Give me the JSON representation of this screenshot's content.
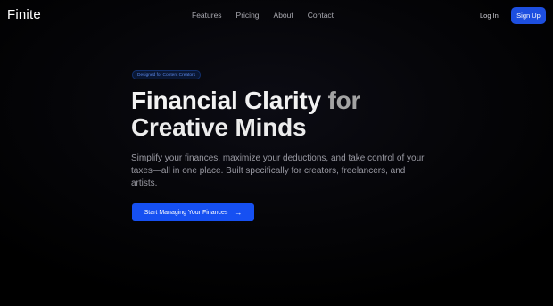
{
  "header": {
    "brand": "Finite",
    "nav": [
      "Features",
      "Pricing",
      "About",
      "Contact"
    ],
    "login_label": "Log In",
    "signup_label": "Sign Up"
  },
  "hero": {
    "badge": "Designed for Content Creators",
    "title_part1": "Financial Clarity",
    "title_part2": " for",
    "title_line2": "Creative Minds",
    "subtitle": "Simplify your finances, maximize your deductions, and take control of your taxes—all in one place. Built specifically for creators, freelancers, and artists.",
    "cta_label": "Start Managing Your Finances",
    "cta_icon": "arrow-right-icon"
  },
  "colors": {
    "background": "#000000",
    "accent": "#1650f2",
    "signup": "#1d4fe0",
    "muted_text": "#9a9aa3"
  }
}
